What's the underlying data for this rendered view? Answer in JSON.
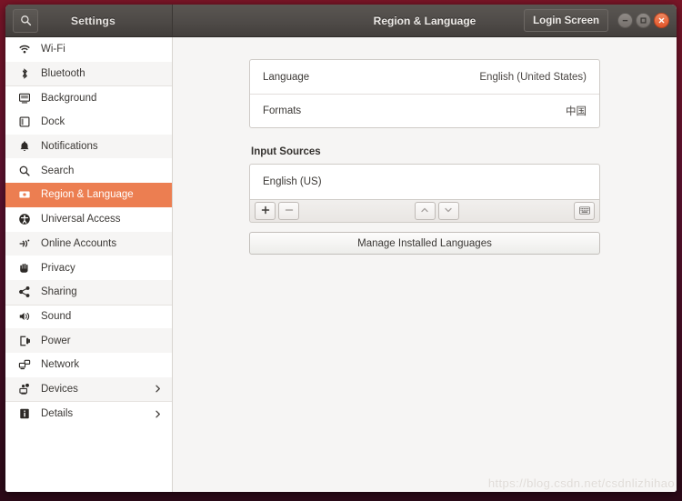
{
  "titlebar": {
    "app_title": "Settings",
    "panel_title": "Region & Language",
    "search_icon": "search-icon",
    "login_screen_label": "Login Screen",
    "window_controls": {
      "minimize": "minimize-icon",
      "maximize": "maximize-icon",
      "close": "close-icon"
    },
    "colors": {
      "titlebar_bg": "#4d4946",
      "close_button": "#e2562a"
    }
  },
  "sidebar": {
    "selected": "Region & Language",
    "accent_color": "#ec7e51",
    "items": [
      {
        "label": "Wi-Fi",
        "icon": "wifi-icon",
        "chevron": false
      },
      {
        "label": "Bluetooth",
        "icon": "bluetooth-icon",
        "chevron": false
      },
      {
        "label": "Background",
        "icon": "background-monitor-icon",
        "chevron": false
      },
      {
        "label": "Dock",
        "icon": "dock-icon",
        "chevron": false
      },
      {
        "label": "Notifications",
        "icon": "bell-icon",
        "chevron": false
      },
      {
        "label": "Search",
        "icon": "search-icon",
        "chevron": false
      },
      {
        "label": "Region & Language",
        "icon": "flag-icon",
        "chevron": false
      },
      {
        "label": "Universal Access",
        "icon": "accessibility-icon",
        "chevron": false
      },
      {
        "label": "Online Accounts",
        "icon": "online-accounts-icon",
        "chevron": false
      },
      {
        "label": "Privacy",
        "icon": "hand-icon",
        "chevron": false
      },
      {
        "label": "Sharing",
        "icon": "share-icon",
        "chevron": false
      },
      {
        "label": "Sound",
        "icon": "speaker-icon",
        "chevron": false
      },
      {
        "label": "Power",
        "icon": "power-battery-icon",
        "chevron": false
      },
      {
        "label": "Network",
        "icon": "network-icon",
        "chevron": false
      },
      {
        "label": "Devices",
        "icon": "devices-icon",
        "chevron": true
      },
      {
        "label": "Details",
        "icon": "info-icon",
        "chevron": true
      }
    ]
  },
  "main": {
    "language_row": {
      "label": "Language",
      "value": "English (United States)"
    },
    "formats_row": {
      "label": "Formats",
      "value": "中国"
    },
    "input_sources": {
      "heading": "Input Sources",
      "entries": [
        "English (US)"
      ],
      "toolbar": {
        "add": "+",
        "remove": "−",
        "move_up": "chevron-up-icon",
        "move_down": "chevron-down-icon",
        "keyboard": "keyboard-icon"
      }
    },
    "manage_button_label": "Manage Installed Languages"
  },
  "watermark": "https://blog.csdn.net/csdnlizhihao"
}
